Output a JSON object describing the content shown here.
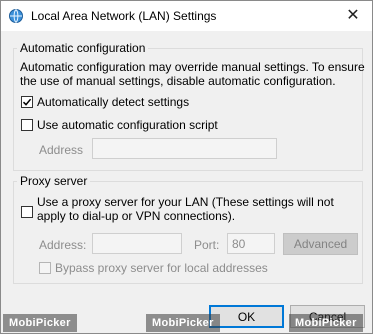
{
  "window": {
    "title": "Local Area Network (LAN) Settings",
    "close_glyph": "✕"
  },
  "automatic": {
    "legend": "Automatic configuration",
    "description": "Automatic configuration may override manual settings.  To ensure the use of manual settings, disable automatic configuration.",
    "detect_label": "Automatically detect settings",
    "detect_checked": true,
    "script_label": "Use automatic configuration script",
    "script_checked": false,
    "address_label": "Address",
    "address_value": ""
  },
  "proxy": {
    "legend": "Proxy server",
    "use_proxy_label": "Use a proxy server for your LAN (These settings will not apply to dial-up or VPN connections).",
    "use_proxy_checked": false,
    "address_label": "Address:",
    "address_value": "",
    "port_label": "Port:",
    "port_value": "80",
    "advanced_label": "Advanced",
    "bypass_label": "Bypass proxy server for local addresses",
    "bypass_checked": false
  },
  "buttons": {
    "ok_label": "OK",
    "cancel_label": "Cancel"
  },
  "watermark": {
    "text": "MobiPicker"
  },
  "icons": {
    "title": "network-globe-icon",
    "check": "checkmark-icon"
  }
}
